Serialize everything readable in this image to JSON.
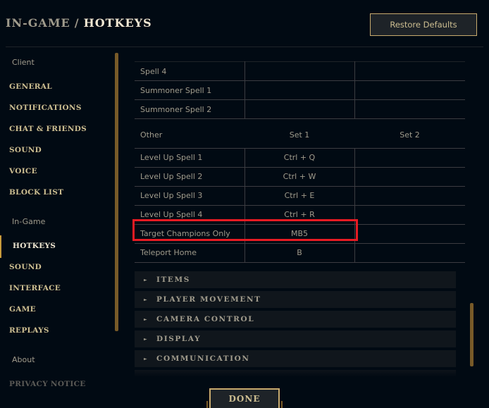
{
  "header": {
    "breadcrumb_parent": "IN-GAME",
    "separator": "/",
    "title": "HOTKEYS",
    "restore_defaults_label": "Restore Defaults"
  },
  "sidebar": {
    "groups": [
      {
        "label": "Client",
        "items": [
          "GENERAL",
          "NOTIFICATIONS",
          "CHAT & FRIENDS",
          "SOUND",
          "VOICE",
          "BLOCK LIST"
        ]
      },
      {
        "label": "In-Game",
        "items": [
          "HOTKEYS",
          "SOUND",
          "INTERFACE",
          "GAME",
          "REPLAYS"
        ]
      },
      {
        "label": "About",
        "items": [
          "PRIVACY NOTICE"
        ]
      }
    ],
    "active_item": "HOTKEYS"
  },
  "abilities_table": {
    "rows": [
      {
        "name": "Spell 4",
        "set1": "",
        "set2": ""
      },
      {
        "name": "Summoner Spell 1",
        "set1": "",
        "set2": ""
      },
      {
        "name": "Summoner Spell 2",
        "set1": "",
        "set2": ""
      }
    ]
  },
  "other_table": {
    "header": {
      "name": "Other",
      "set1": "Set 1",
      "set2": "Set 2"
    },
    "rows": [
      {
        "name": "Level Up Spell 1",
        "set1": "Ctrl + Q",
        "set2": ""
      },
      {
        "name": "Level Up Spell 2",
        "set1": "Ctrl + W",
        "set2": ""
      },
      {
        "name": "Level Up Spell 3",
        "set1": "Ctrl + E",
        "set2": ""
      },
      {
        "name": "Level Up Spell 4",
        "set1": "Ctrl + R",
        "set2": ""
      },
      {
        "name": "Target Champions Only",
        "set1": "MB5",
        "set2": ""
      },
      {
        "name": "Teleport Home",
        "set1": "B",
        "set2": ""
      }
    ],
    "highlighted_row": "Target Champions Only"
  },
  "sections": [
    "ITEMS",
    "PLAYER MOVEMENT",
    "CAMERA CONTROL",
    "DISPLAY",
    "COMMUNICATION"
  ],
  "footer": {
    "done_label": "DONE"
  },
  "colors": {
    "background": "#010a13",
    "gold": "#c8aa6e",
    "gold_text": "#cdbe91",
    "highlight": "#e81b23",
    "scrollbar": "#785a28"
  }
}
